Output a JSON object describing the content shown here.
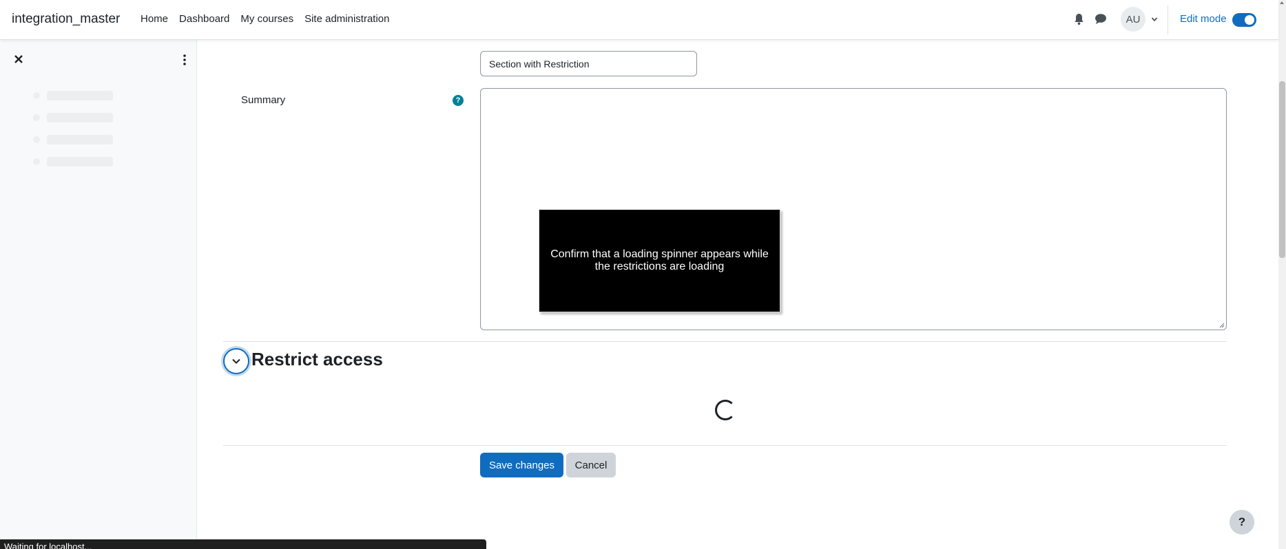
{
  "navbar": {
    "brand": "integration_master",
    "links": [
      "Home",
      "Dashboard",
      "My courses",
      "Site administration"
    ],
    "avatar_initials": "AU",
    "edit_mode_label": "Edit mode",
    "edit_mode_on": true
  },
  "form": {
    "section_name_value": "Section with Restriction",
    "summary_label": "Summary",
    "help_glyph": "?",
    "restrict_heading": "Restrict access",
    "save_label": "Save changes",
    "cancel_label": "Cancel"
  },
  "callout": {
    "text": "Confirm that a loading spinner appears while the restrictions are loading"
  },
  "help_fab": "?",
  "statusbar": "Waiting for localhost...",
  "colors": {
    "primary": "#0f6cbf",
    "help_teal": "#008196",
    "secondary_button": "#ced4da"
  },
  "icons": [
    "bell-icon",
    "chat-icon",
    "chevron-down-icon",
    "close-icon",
    "kebab-menu-icon",
    "help-icon",
    "loading-spinner-icon"
  ]
}
